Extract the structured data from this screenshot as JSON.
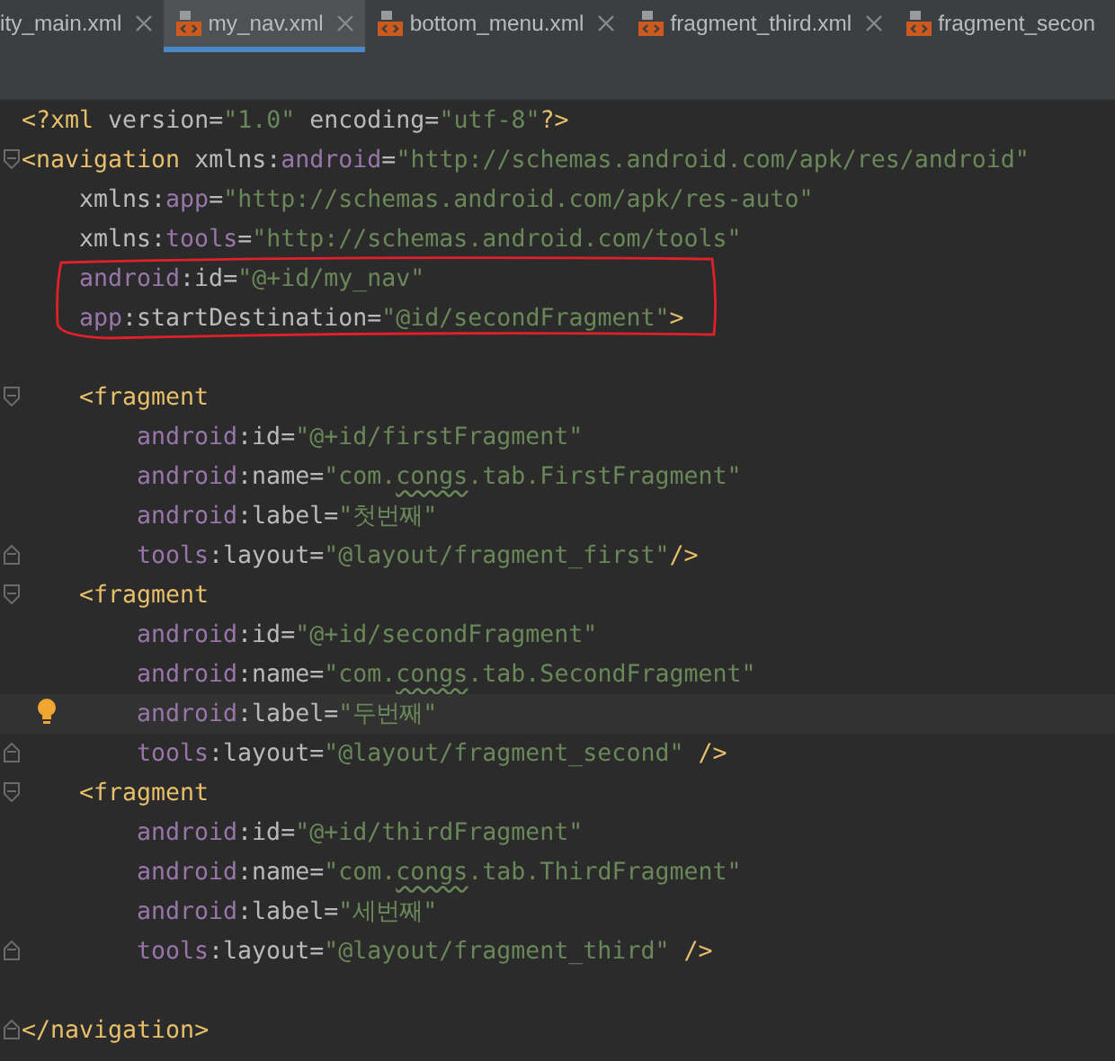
{
  "tabs": [
    {
      "label": "ity_main.xml",
      "selected": false,
      "icon": false,
      "cut": false
    },
    {
      "label": "my_nav.xml",
      "selected": true,
      "icon": true,
      "cut": false
    },
    {
      "label": "bottom_menu.xml",
      "selected": false,
      "icon": true,
      "cut": false
    },
    {
      "label": "fragment_third.xml",
      "selected": false,
      "icon": true,
      "cut": false
    },
    {
      "label": "fragment_secon",
      "selected": false,
      "icon": true,
      "cut": true
    }
  ],
  "lines": [
    {
      "kind": "code",
      "tokens": [
        {
          "kind": "tag",
          "text": "<?xml "
        },
        {
          "kind": "attr",
          "text": "version="
        },
        {
          "kind": "str",
          "text": "\"1.0\" "
        },
        {
          "kind": "attr",
          "text": "encoding="
        },
        {
          "kind": "str",
          "text": "\"utf-8\""
        },
        {
          "kind": "tag",
          "text": "?>"
        }
      ]
    },
    {
      "kind": "code",
      "fold_start": true,
      "tokens": [
        {
          "kind": "tag",
          "text": "<navigation "
        },
        {
          "kind": "attr",
          "text": "xmlns:"
        },
        {
          "kind": "ns",
          "text": "android"
        },
        {
          "kind": "attr",
          "text": "="
        },
        {
          "kind": "str",
          "text": "\"http://schemas.android.com/apk/res/android\""
        }
      ],
      "children": [
        {
          "kind": "code",
          "tokens": [
            {
              "kind": "attr",
              "text": "xmlns:"
            },
            {
              "kind": "ns",
              "text": "app"
            },
            {
              "kind": "attr",
              "text": "="
            },
            {
              "kind": "str",
              "text": "\"http://schemas.android.com/apk/res-auto\""
            }
          ]
        },
        {
          "kind": "code",
          "tokens": [
            {
              "kind": "attr",
              "text": "xmlns:"
            },
            {
              "kind": "ns",
              "text": "tools"
            },
            {
              "kind": "attr",
              "text": "="
            },
            {
              "kind": "str",
              "text": "\"http://schemas.android.com/tools\""
            }
          ]
        },
        {
          "kind": "code",
          "boxed": true,
          "tokens": [
            {
              "kind": "ns",
              "text": "android"
            },
            {
              "kind": "attr",
              "text": ":id="
            },
            {
              "kind": "str",
              "text": "\"@+id/my_nav\""
            }
          ]
        },
        {
          "kind": "code",
          "boxed": true,
          "tokens": [
            {
              "kind": "ns",
              "text": "app"
            },
            {
              "kind": "attr",
              "text": ":startDestination="
            },
            {
              "kind": "str",
              "text": "\"@id/secondFragment\""
            },
            {
              "kind": "tag",
              "text": ">"
            }
          ]
        },
        {
          "kind": "blank"
        },
        {
          "kind": "code",
          "fold_start": true,
          "tokens": [
            {
              "kind": "tag",
              "text": "<fragment"
            }
          ],
          "children": [
            {
              "kind": "code",
              "tokens": [
                {
                  "kind": "ns",
                  "text": "android"
                },
                {
                  "kind": "attr",
                  "text": ":id="
                },
                {
                  "kind": "str",
                  "text": "\"@+id/firstFragment\""
                }
              ]
            },
            {
              "kind": "code",
              "tokens": [
                {
                  "kind": "ns",
                  "text": "android"
                },
                {
                  "kind": "attr",
                  "text": ":name="
                },
                {
                  "kind": "str",
                  "text": "\"com."
                },
                {
                  "kind": "typo",
                  "text": "congs"
                },
                {
                  "kind": "str",
                  "text": ".tab.FirstFragment\""
                }
              ]
            },
            {
              "kind": "code",
              "tokens": [
                {
                  "kind": "ns",
                  "text": "android"
                },
                {
                  "kind": "attr",
                  "text": ":label="
                },
                {
                  "kind": "str",
                  "text": "\"첫번째\""
                }
              ]
            },
            {
              "kind": "code",
              "fold_end": true,
              "tokens": [
                {
                  "kind": "ns",
                  "text": "tools"
                },
                {
                  "kind": "attr",
                  "text": ":layout="
                },
                {
                  "kind": "str",
                  "text": "\"@layout/fragment_first\""
                },
                {
                  "kind": "tag",
                  "text": "/>"
                }
              ]
            }
          ]
        },
        {
          "kind": "code",
          "fold_start": true,
          "tokens": [
            {
              "kind": "tag",
              "text": "<fragment"
            }
          ],
          "children": [
            {
              "kind": "code",
              "tokens": [
                {
                  "kind": "ns",
                  "text": "android"
                },
                {
                  "kind": "attr",
                  "text": ":id="
                },
                {
                  "kind": "str",
                  "text": "\"@+id/secondFragment\""
                }
              ]
            },
            {
              "kind": "code",
              "tokens": [
                {
                  "kind": "ns",
                  "text": "android"
                },
                {
                  "kind": "attr",
                  "text": ":name="
                },
                {
                  "kind": "str",
                  "text": "\"com."
                },
                {
                  "kind": "typo",
                  "text": "congs"
                },
                {
                  "kind": "str",
                  "text": ".tab.SecondFragment\""
                }
              ]
            },
            {
              "kind": "code",
              "current": true,
              "hint": true,
              "tokens": [
                {
                  "kind": "ns",
                  "text": "android"
                },
                {
                  "kind": "attr",
                  "text": ":label="
                },
                {
                  "kind": "str",
                  "text": "\"두번째\""
                }
              ]
            },
            {
              "kind": "code",
              "fold_end": true,
              "tokens": [
                {
                  "kind": "ns",
                  "text": "tools"
                },
                {
                  "kind": "attr",
                  "text": ":layout="
                },
                {
                  "kind": "str",
                  "text": "\"@layout/fragment_second\" "
                },
                {
                  "kind": "tag",
                  "text": "/>"
                }
              ]
            }
          ]
        },
        {
          "kind": "code",
          "fold_start": true,
          "tokens": [
            {
              "kind": "tag",
              "text": "<fragment"
            }
          ],
          "children": [
            {
              "kind": "code",
              "tokens": [
                {
                  "kind": "ns",
                  "text": "android"
                },
                {
                  "kind": "attr",
                  "text": ":id="
                },
                {
                  "kind": "str",
                  "text": "\"@+id/thirdFragment\""
                }
              ]
            },
            {
              "kind": "code",
              "tokens": [
                {
                  "kind": "ns",
                  "text": "android"
                },
                {
                  "kind": "attr",
                  "text": ":name="
                },
                {
                  "kind": "str",
                  "text": "\"com."
                },
                {
                  "kind": "typo",
                  "text": "congs"
                },
                {
                  "kind": "str",
                  "text": ".tab.ThirdFragment\""
                }
              ]
            },
            {
              "kind": "code",
              "tokens": [
                {
                  "kind": "ns",
                  "text": "android"
                },
                {
                  "kind": "attr",
                  "text": ":label="
                },
                {
                  "kind": "str",
                  "text": "\"세번째\""
                }
              ]
            },
            {
              "kind": "code",
              "fold_end": true,
              "tokens": [
                {
                  "kind": "ns",
                  "text": "tools"
                },
                {
                  "kind": "attr",
                  "text": ":layout="
                },
                {
                  "kind": "str",
                  "text": "\"@layout/fragment_third\" "
                },
                {
                  "kind": "tag",
                  "text": "/>"
                }
              ]
            }
          ]
        }
      ]
    },
    {
      "kind": "blank"
    },
    {
      "kind": "code",
      "fold_end": true,
      "tokens": [
        {
          "kind": "tag",
          "text": "</navigation>"
        }
      ]
    }
  ]
}
